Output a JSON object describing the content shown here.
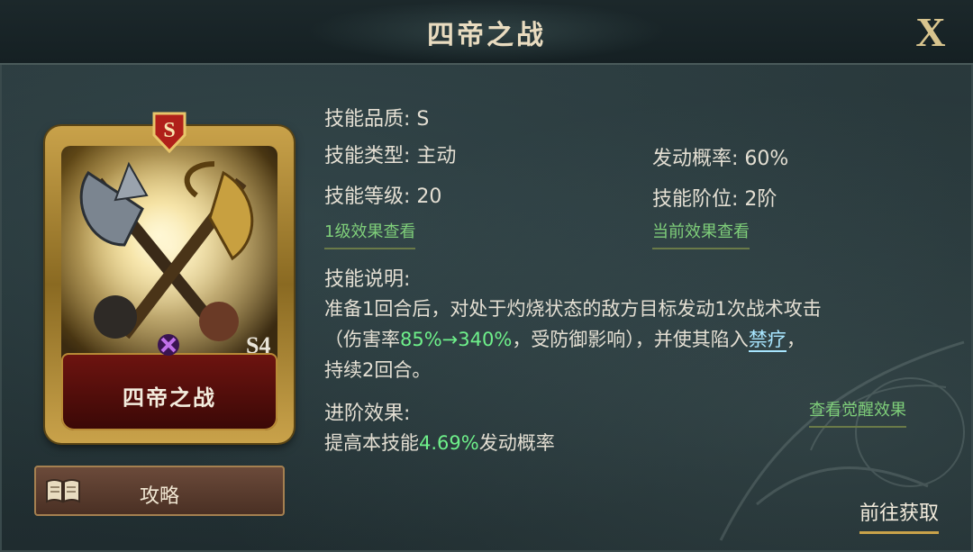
{
  "title": "四帝之战",
  "close_label": "X",
  "card": {
    "rank": "S",
    "name": "四帝之战",
    "corner_mark": "S4"
  },
  "guide_button": {
    "label": "攻略",
    "icon": "book-icon"
  },
  "stats": {
    "quality": "技能品质: S",
    "type": "技能类型: 主动",
    "level": "技能等级: 20",
    "rate": "发动概率: 60%",
    "tier": "技能阶位: 2阶"
  },
  "links": {
    "level1": "1级效果查看",
    "current": "当前效果查看",
    "awaken": "查看觉醒效果"
  },
  "description": {
    "heading": "技能说明:",
    "line1": "准备1回合后，对处于灼烧状态的敌方目标发动1次战术攻击",
    "line2_pre": "（伤害率",
    "line2_value": "85%→340%",
    "line2_mid": "，受防御影响），并使其陷入",
    "line2_keyword": "禁疗",
    "line2_post": "，",
    "line3": "持续2回合。"
  },
  "advance": {
    "heading": "进阶效果:",
    "pre": "提高本技能",
    "value": "4.69%",
    "post": "发动概率"
  },
  "acquire_label": "前往获取",
  "colors": {
    "accent_gold": "#c9a24a",
    "highlight_green": "#6ef08a",
    "keyword_blue": "#a8e6ff",
    "link_green": "#7fcf7a"
  }
}
